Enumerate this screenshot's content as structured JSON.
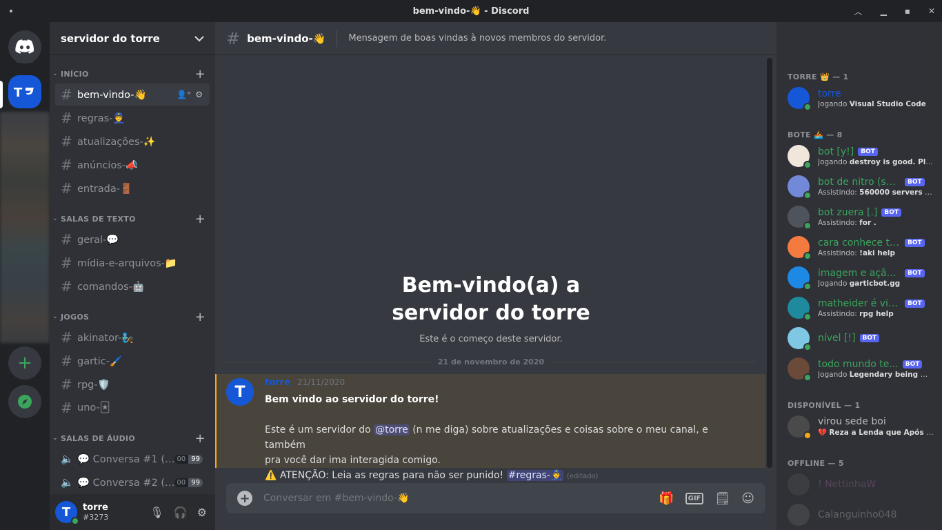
{
  "window": {
    "title": "bem-vindo-👋 - Discord"
  },
  "server": {
    "name": "servidor do torre"
  },
  "categories": {
    "inicio": "INÍCIO",
    "texto": "SALAS DE TEXTO",
    "jogos": "JOGOS",
    "audio": "SALAS DE ÁUDIO"
  },
  "channels": {
    "inicio": [
      "bem-vindo-👋",
      "regras-👮",
      "atualizações-✨",
      "anúncios-📣",
      "entrada-🚪"
    ],
    "texto": [
      "geral-💬",
      "mídia-e-arquivos-📁",
      "comandos-🤖"
    ],
    "jogos": [
      "akinator-🧞",
      "gartic-🖌️",
      "rpg-🛡️",
      "uno-🃏"
    ],
    "audio": [
      {
        "name": "💬 Conversa #1 (…",
        "a": "00",
        "b": "99"
      },
      {
        "name": "💬 Conversa #2 (…",
        "a": "00",
        "b": "99"
      }
    ]
  },
  "user": {
    "name": "torre",
    "tag": "#3273",
    "initial": "T"
  },
  "topbar": {
    "channel": "bem-vindo-👋",
    "topic": "Mensagem de boas vindas à novos membros do servidor."
  },
  "welcome": {
    "line1": "Bem-vindo(a) a",
    "line2": "servidor do torre",
    "sub": "Este é o começo deste servidor."
  },
  "date_divider": "21 de novembro de 2020",
  "message": {
    "author": "torre",
    "timestamp": "21/11/2020",
    "line1": "Bem vindo ao servidor do torre!",
    "line2a": "Este é um servidor do ",
    "mention_user": "@torre",
    "line2b": " (n me diga) sobre atualizações e coisas sobre o meu canal, e também",
    "line3": "pra você dar ima interagida comigo.",
    "line4": "⚠️ ATENÇÃO: Leia as regras para não ser punido! ",
    "mention_channel": "#regras-👮",
    "edited": "(editado)"
  },
  "composer": {
    "placeholder": "Conversar em #bem-vindo-👋"
  },
  "member_groups": {
    "torre": "TORRE 👑 — 1",
    "bote": "BOTE 🚣 — 8",
    "disponivel": "DISPONÍVEL — 1",
    "offline": "OFFLINE — 5"
  },
  "members": {
    "torre": [
      {
        "name": "torre",
        "activity_prefix": "Jogando ",
        "activity": "Visual Studio Code",
        "color": "#1657d8",
        "avatar_bg": "#1657d8"
      }
    ],
    "bote": [
      {
        "name": "bot [y!]",
        "activity_prefix": "Jogando ",
        "activity": "destroy is good. Pls lo...",
        "color": "#3ba55c",
        "avatar_bg": "#f0e6dc"
      },
      {
        "name": "bot de nitro (sq...",
        "activity_prefix": "Assistindo: ",
        "activity": "560000 servers a...",
        "color": "#3ba55c",
        "avatar_bg": "#7289da"
      },
      {
        "name": "bot zuera [.]",
        "activity_prefix": "Assistindo: ",
        "activity": "for .",
        "color": "#3ba55c",
        "avatar_bg": "#4f545c"
      },
      {
        "name": "cara conhece to...",
        "activity_prefix": "Assistindo: ",
        "activity": "!aki help",
        "color": "#3ba55c",
        "avatar_bg": "#f47b40"
      },
      {
        "name": "imagem e ação ...",
        "activity_prefix": "Jogando ",
        "activity": "garticbot.gg",
        "color": "#3ba55c",
        "avatar_bg": "#1e88e5"
      },
      {
        "name": "matheider é vici...",
        "activity_prefix": "Assistindo: ",
        "activity": "rpg help",
        "color": "#3ba55c",
        "avatar_bg": "#1f8a9e"
      },
      {
        "name": "nível [!]",
        "activity_prefix": "",
        "activity": "",
        "color": "#3ba55c",
        "avatar_bg": "#7ec8e3"
      },
      {
        "name": "todo mundo te...",
        "activity_prefix": "Jogando ",
        "activity": "Legendary being mad...",
        "color": "#3ba55c",
        "avatar_bg": "#6b4a3a"
      }
    ],
    "disponivel": [
      {
        "name": "virou sede boi",
        "activity_prefix": "💔 ",
        "activity": "Reza a Lenda que Após ...",
        "color": "#b9bbbe",
        "avatar_bg": "#4a4a4a"
      }
    ],
    "offline": [
      {
        "name": "! NettinhaW",
        "color": "#a36b9c",
        "avatar_bg": "#555"
      },
      {
        "name": "Calanguinho048",
        "color": "#b9bbbe",
        "avatar_bg": "#666"
      }
    ]
  },
  "bot_badge": "BOT"
}
